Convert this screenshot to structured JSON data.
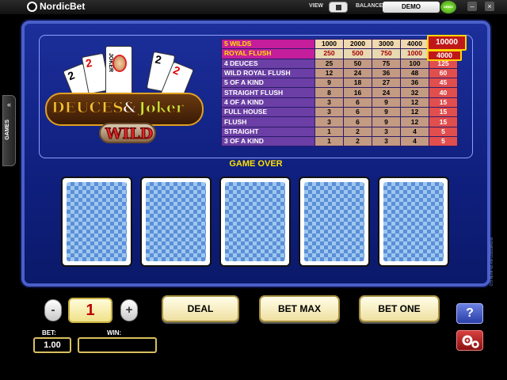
{
  "topbar": {
    "brand": "NordicBet",
    "view_label": "VIEW",
    "balance_label": "BALANCE:",
    "balance_value": "DEMO",
    "demo_badge": "DEMO",
    "minimize": "–",
    "close": "×"
  },
  "side": {
    "games_label": "GAMES",
    "games_arrows": "«",
    "powered_by": "POWERED BY PLAY'N GO"
  },
  "game": {
    "logo_title_left": "DEUCES",
    "logo_amp": "&",
    "logo_title_right": "Joker",
    "logo_wild": "WILD",
    "joker_text": "JOKER",
    "status": "GAME OVER"
  },
  "paytable": {
    "rows": [
      {
        "label": "5 WILDS",
        "values": [
          "1000",
          "2000",
          "3000",
          "4000",
          "10000"
        ]
      },
      {
        "label": "ROYAL FLUSH",
        "values": [
          "250",
          "500",
          "750",
          "1000",
          "4000"
        ]
      },
      {
        "label": "4 DEUCES",
        "values": [
          "25",
          "50",
          "75",
          "100",
          "125"
        ]
      },
      {
        "label": "WILD ROYAL FLUSH",
        "values": [
          "12",
          "24",
          "36",
          "48",
          "60"
        ]
      },
      {
        "label": "5 OF A KIND",
        "values": [
          "9",
          "18",
          "27",
          "36",
          "45"
        ]
      },
      {
        "label": "STRAIGHT FLUSH",
        "values": [
          "8",
          "16",
          "24",
          "32",
          "40"
        ]
      },
      {
        "label": "4 OF A KIND",
        "values": [
          "3",
          "6",
          "9",
          "12",
          "15"
        ]
      },
      {
        "label": "FULL HOUSE",
        "values": [
          "3",
          "6",
          "9",
          "12",
          "15"
        ]
      },
      {
        "label": "FLUSH",
        "values": [
          "3",
          "6",
          "9",
          "12",
          "15"
        ]
      },
      {
        "label": "STRAIGHT",
        "values": [
          "1",
          "2",
          "3",
          "4",
          "5"
        ]
      },
      {
        "label": "3 OF A KIND",
        "values": [
          "1",
          "2",
          "3",
          "4",
          "5"
        ]
      }
    ]
  },
  "controls": {
    "minus": "-",
    "plus": "+",
    "coins": "1",
    "deal": "DEAL",
    "bet_max": "BET MAX",
    "bet_one": "BET ONE",
    "bet_label": "BET:",
    "bet_value": "1.00",
    "win_label": "WIN:",
    "win_value": "",
    "help": "?"
  },
  "colors": {
    "panel": "#13238a",
    "status_text": "#ffe000",
    "card_back": "#5a8fd8"
  }
}
